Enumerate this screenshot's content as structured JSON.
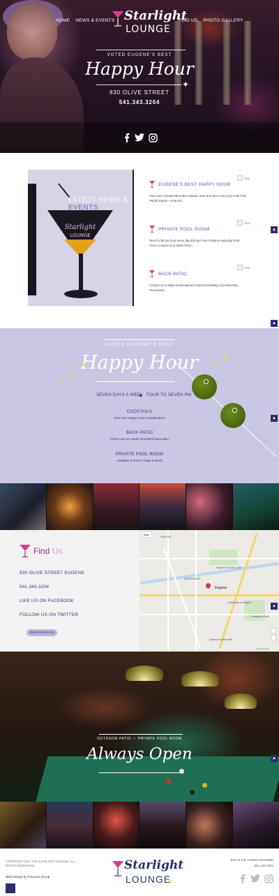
{
  "nav": {
    "home": "HOME",
    "news": "NEWS & EVENTS",
    "find": "FIND US",
    "gallery": "PHOTO GALLERY"
  },
  "logo": {
    "line1": "Starlight",
    "line2": "LOUNGE"
  },
  "hero": {
    "voted": "VOTED EUGENE'S BEST",
    "happy_hour": "Happy Hour",
    "address": "830 OLIVE STREET",
    "phone": "541.343.3204"
  },
  "social_icons": [
    "facebook-icon",
    "twitter-icon",
    "instagram-icon"
  ],
  "news": {
    "title_a": "LATEST NEWS & ",
    "title_b": "EVENTS",
    "items": [
      {
        "date": "Sep",
        "title": "EUGENE'S BEST HAPPY HOUR",
        "body": "View Our Cocktail Menu $3 cocktails, beer and wine every day 4:00-7:00 PM $3 Patron + 9:30-10:..."
      },
      {
        "date": "Sep",
        "title": "PRIVATE POOL ROOM",
        "body": "Rent for $5 per hour every day $10 per hour Friday & Saturday 9:30-Close Contact us to Make Rese..."
      },
      {
        "date": "Sep",
        "title": "BACK PATIO",
        "body": "Contact us to Make Reservations Covered Smoking Area Recently Renovated..."
      }
    ]
  },
  "happy": {
    "voted": "VOTED EUGENE'S BEST",
    "title": "Happy Hour",
    "days": "SEVEN DAYS A WEEK",
    "time": "FOUR TO SEVEN PM",
    "blocks": [
      {
        "title": "COCKTAILS",
        "sub": "View Our Happy Hour Cocktail Menu"
      },
      {
        "title": "BACK PATIO",
        "sub": "Check out our newly renovated back patio"
      },
      {
        "title": "PRIVATE POOL ROOM",
        "sub": "Available to Rent 7 Days a Week"
      }
    ]
  },
  "find": {
    "title_a": "Find",
    "title_b": " Us",
    "address": "830 OLIVE STREET EUGENE",
    "phone": "541.343.3204",
    "facebook": "LIKE US ON FACEBOOK",
    "twitter": "FOLLOW US ON TWITTER",
    "send": "SEND MESSAGE"
  },
  "map": {
    "tab": "Map",
    "labels": [
      "River Rd",
      "Eugene Country Club",
      "WHITEAKER",
      "Eugene",
      "University of Oregon",
      "Hendricks Park",
      "Spencer Butte Park",
      "Terms of Use"
    ]
  },
  "pool": {
    "tag_a": "OUTDOOR PATIO",
    "tag_b": "PRIVATE POOL ROOM",
    "title": "Always Open"
  },
  "footer": {
    "copyright": "COPYRIGHT 2017 THE STARLIGHT LOUNGE. ALL RIGHTS RESERVED.",
    "design": "Web Design by Freyman Group",
    "address": "830 OLIVE STREET EUGENE",
    "phone": "541.343.3204"
  },
  "colors": {
    "purple": "#6c4ca6",
    "navy": "#2c2f6b",
    "lavender": "#c9c7e3",
    "magenta": "#9b2a80",
    "olive": "#4a6310",
    "star": "#f2e21a"
  }
}
